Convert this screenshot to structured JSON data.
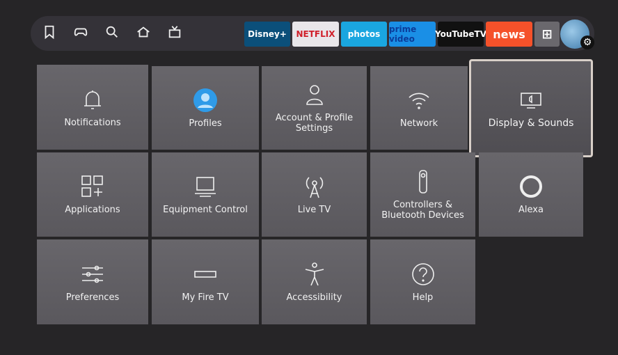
{
  "nav": [
    {
      "icon": "bookmark-icon"
    },
    {
      "icon": "gamepad-icon"
    },
    {
      "icon": "search-icon"
    },
    {
      "icon": "home-icon"
    },
    {
      "icon": "tv-icon"
    }
  ],
  "apps": [
    {
      "label": "Disney+",
      "bg": "#0b4f7a",
      "color": "#ffffff"
    },
    {
      "label": "NETFLIX",
      "bg": "#e9e6ea",
      "color": "#d01f2a"
    },
    {
      "label": "photos",
      "bg": "#1aa6e0",
      "color": "#ffffff"
    },
    {
      "label": "prime video",
      "bg": "#1a8fe6",
      "color": "#0b3c9a"
    },
    {
      "label": "YouTubeTV",
      "bg": "#111111",
      "color": "#ffffff"
    },
    {
      "label": "news",
      "bg": "#f5512a",
      "color": "#ffffff"
    },
    {
      "label": "",
      "icon": "apps-grid-icon",
      "bg": "#6a686d",
      "color": "#ffffff"
    }
  ],
  "tiles": [
    {
      "label": "Notifications",
      "icon": "bell-icon"
    },
    {
      "label": "Profiles",
      "icon": "profile-avatar-icon"
    },
    {
      "label": "Account & Profile Settings",
      "icon": "person-icon"
    },
    {
      "label": "Network",
      "icon": "wifi-icon"
    },
    {
      "label": "Display & Sounds",
      "icon": "display-icon",
      "focused": true
    },
    {
      "label": "Applications",
      "icon": "apps-icon"
    },
    {
      "label": "Equipment Control",
      "icon": "monitor-icon"
    },
    {
      "label": "Live TV",
      "icon": "antenna-icon"
    },
    {
      "label": "Controllers & Bluetooth Devices",
      "icon": "remote-icon"
    },
    {
      "label": "Alexa",
      "icon": "alexa-icon"
    },
    {
      "label": "Preferences",
      "icon": "sliders-icon"
    },
    {
      "label": "My Fire TV",
      "icon": "firetv-stick-icon"
    },
    {
      "label": "Accessibility",
      "icon": "accessibility-icon"
    },
    {
      "label": "Help",
      "icon": "help-icon"
    }
  ]
}
